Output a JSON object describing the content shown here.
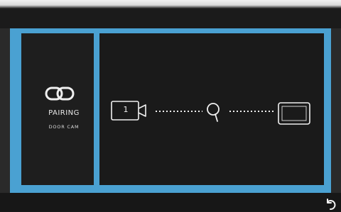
{
  "pairing": {
    "title": "PAIRING",
    "subtitle": "DOOR CAM",
    "icon": "link-icon"
  },
  "devices": {
    "camera_number": "1",
    "camera_icon": "camera-icon",
    "search_icon": "search-icon",
    "monitor_icon": "monitor-icon"
  },
  "controls": {
    "back_icon": "back-icon"
  },
  "colors": {
    "frame_accent": "#4aa1d2",
    "panel_bg": "#1e1e1e",
    "foreground": "#f0f0f0"
  }
}
